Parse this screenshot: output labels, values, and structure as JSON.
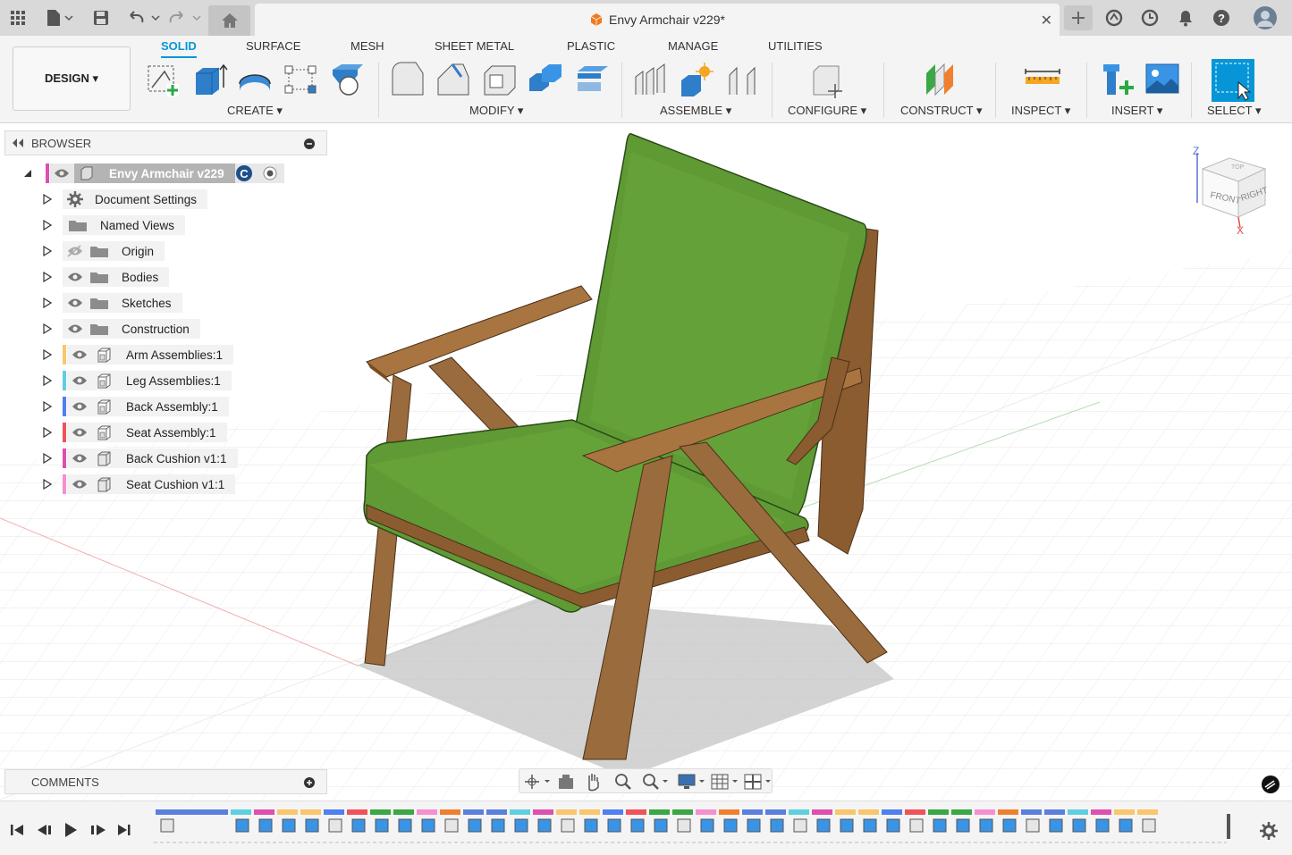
{
  "window": {
    "doc_title": "Envy Armchair v229*"
  },
  "ribbon": {
    "workspace_button": "DESIGN ▾",
    "tabs": [
      "SOLID",
      "SURFACE",
      "MESH",
      "SHEET METAL",
      "PLASTIC",
      "MANAGE",
      "UTILITIES"
    ],
    "groups": [
      "CREATE ▾",
      "MODIFY ▾",
      "ASSEMBLE ▾",
      "CONFIGURE ▾",
      "CONSTRUCT ▾",
      "INSPECT ▾",
      "INSERT ▾",
      "SELECT ▾"
    ]
  },
  "browser": {
    "title": "BROWSER",
    "root": "Envy Armchair v229",
    "items": [
      {
        "label": "Document Settings",
        "icon": "gear-icon"
      },
      {
        "label": "Named Views",
        "icon": "folder-icon"
      },
      {
        "label": "Origin",
        "icon": "folder-icon",
        "hidden": true
      },
      {
        "label": "Bodies",
        "icon": "folder-icon"
      },
      {
        "label": "Sketches",
        "icon": "folder-icon"
      },
      {
        "label": "Construction",
        "icon": "folder-icon"
      },
      {
        "label": "Arm Assemblies:1",
        "icon": "component-icon",
        "color": "#f9c66b"
      },
      {
        "label": "Leg Assemblies:1",
        "icon": "component-icon",
        "color": "#5fcfdf"
      },
      {
        "label": "Back Assembly:1",
        "icon": "component-icon",
        "color": "#4f7ff0"
      },
      {
        "label": "Seat Assembly:1",
        "icon": "component-icon",
        "color": "#f0525a"
      },
      {
        "label": "Back Cushion v1:1",
        "icon": "body-icon",
        "color": "#e04fb0"
      },
      {
        "label": "Seat Cushion v1:1",
        "icon": "body-icon",
        "color": "#f58fd0"
      }
    ]
  },
  "viewcube": {
    "front": "FRONT",
    "right": "RIGHT",
    "top": "TOP",
    "axis_z": "Z",
    "axis_x": "X"
  },
  "comments": {
    "title": "COMMENTS"
  },
  "colors": {
    "accent": "#0696d7",
    "cushion": "#5f9a35",
    "wood": "#9a6b3c"
  }
}
